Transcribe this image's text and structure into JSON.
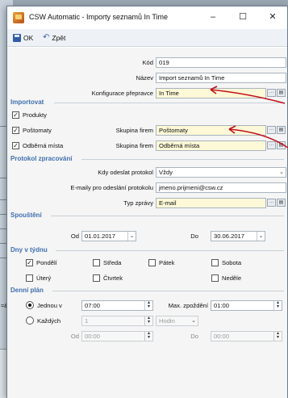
{
  "window": {
    "title": "CSW Automatic - Importy seznamů In Time"
  },
  "titlebar_buttons": {
    "minimize": "–",
    "maximize": "☐",
    "close": "✕"
  },
  "toolbar": {
    "ok_label": "OK",
    "back_label": "Zpět"
  },
  "form": {
    "kod_label": "Kód",
    "kod_value": "019",
    "nazev_label": "Název",
    "nazev_value": "Import seznamů In Time",
    "konfig_label": "Konfigurace přepravce",
    "konfig_value": "In Time"
  },
  "importovat": {
    "title": "Importovat",
    "produkty": "Produkty",
    "postomaty": "Poštomaty",
    "odberna": "Odběrná místa",
    "skupina_label": "Skupina firem",
    "skupina1_value": "Poštomaty",
    "skupina2_value": "Odběrná místa"
  },
  "protokol": {
    "title": "Protokol zpracování",
    "kdy_label": "Kdy odeslat protokol",
    "kdy_value": "Vždy",
    "emaily_label": "E-maily pro odeslání protokolu",
    "emaily_value": "jmeno.prijmeni@csw.cz",
    "typ_label": "Typ zprávy",
    "typ_value": "E-mail"
  },
  "spousteni": {
    "title": "Spouštění",
    "od_label": "Od",
    "od_value": "01.01.2017",
    "do_label": "Do",
    "do_value": "30.06.2017"
  },
  "dny": {
    "title": "Dny v týdnu",
    "pondeli": "Pondělí",
    "streda": "Středa",
    "patek": "Pátek",
    "sobota": "Sobota",
    "utery": "Úterý",
    "ctvrtek": "Čtvrtek",
    "nedele": "Neděle"
  },
  "plan": {
    "title": "Denní plán",
    "jednou_label": "Jednou v",
    "jednou_value": "07:00",
    "max_label": "Max. zpoždění",
    "max_value": "01:00",
    "kazdych_label": "Každých",
    "kazdych_value": "1",
    "unit_value": "Hodin",
    "od_label": "Od",
    "od_value": "00:00",
    "do_label": "Do",
    "do_value": "00:00"
  },
  "background": {
    "side_text": "=&c"
  },
  "colors": {
    "section": "#3f6fb0",
    "highlight": "#fdf8d7",
    "arrow": "#c0121b"
  }
}
